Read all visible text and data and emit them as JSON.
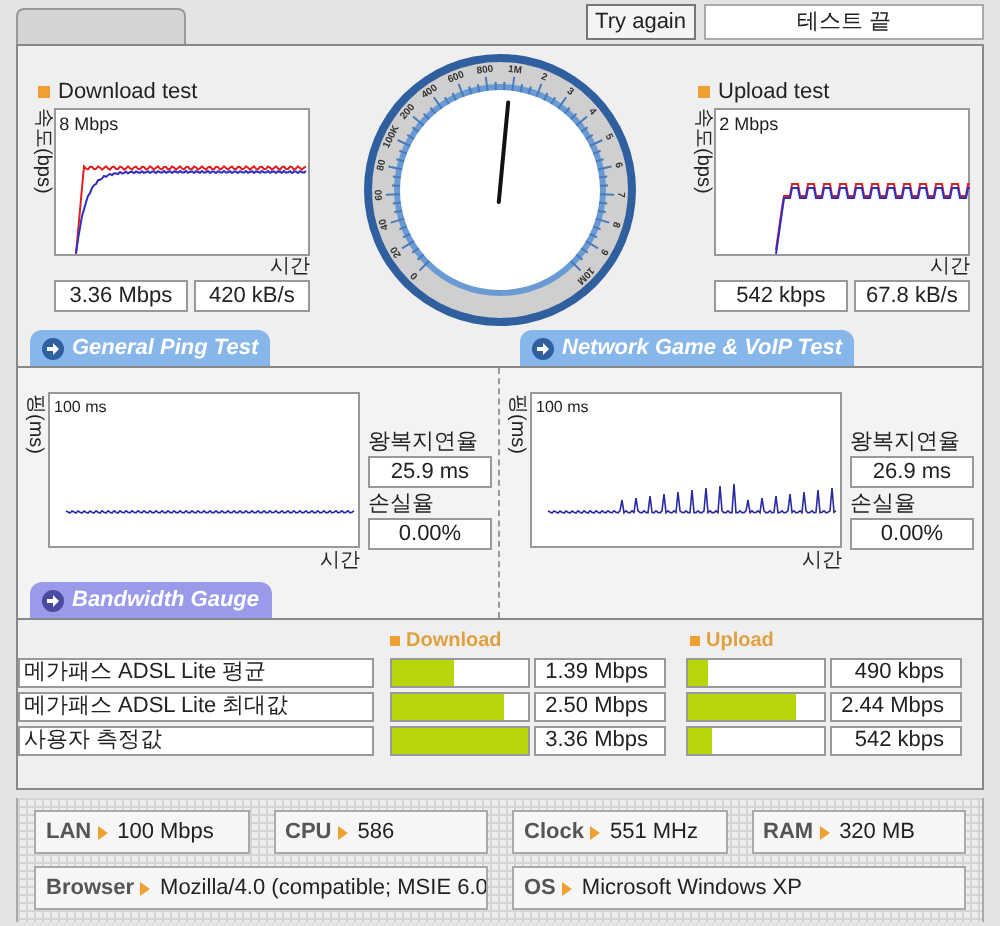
{
  "toolbar": {
    "retry_button": "Try again",
    "status": "테스트 끝"
  },
  "download": {
    "title": "Download test",
    "y_label": "속도(bps)",
    "max": "8 Mbps",
    "x_label": "시간",
    "speed": "3.36 Mbps",
    "rate": "420 kB/s"
  },
  "gauge": {
    "labels": [
      "0",
      "20",
      "40",
      "60",
      "80",
      "100K",
      "200",
      "400",
      "600",
      "800",
      "1M",
      "2",
      "3",
      "4",
      "5",
      "6",
      "7",
      "8",
      "9",
      "10M"
    ],
    "level": 0.52
  },
  "upload": {
    "title": "Upload test",
    "y_label": "속도(bps)",
    "max": "2 Mbps",
    "x_label": "시간",
    "speed": "542 kbps",
    "rate": "67.8 kB/s"
  },
  "ping_tabs": [
    "General Ping Test",
    "Network Game & VoIP Test"
  ],
  "ping": [
    {
      "y_label": "핑(ms)",
      "max": "100 ms",
      "x_label": "시간",
      "latency_label": "왕복지연율",
      "latency": "25.9 ms",
      "loss_label": "손실율",
      "loss": "0.00%"
    },
    {
      "y_label": "핑(ms)",
      "max": "100 ms",
      "x_label": "시간",
      "latency_label": "왕복지연율",
      "latency": "26.9 ms",
      "loss_label": "손실율",
      "loss": "0.00%"
    }
  ],
  "bandwidth": {
    "title": "Bandwidth Gauge",
    "download_header": "Download",
    "upload_header": "Upload",
    "rows": [
      {
        "label": "메가패스 ADSL Lite 평균",
        "download": {
          "level": 0.45,
          "value": "1.39 Mbps"
        },
        "upload": {
          "level": 0.15,
          "value": "490 kbps"
        }
      },
      {
        "label": "메가패스 ADSL Lite 최대값",
        "download": {
          "level": 0.83,
          "value": "2.50 Mbps"
        },
        "upload": {
          "level": 0.79,
          "value": "2.44 Mbps"
        }
      },
      {
        "label": "사용자 측정값",
        "download": {
          "level": 1.0,
          "value": "3.36 Mbps"
        },
        "upload": {
          "level": 0.17,
          "value": "542 kbps"
        }
      }
    ]
  },
  "system_info": [
    {
      "label": "LAN",
      "value": "100 Mbps"
    },
    {
      "label": "CPU",
      "value": "586"
    },
    {
      "label": "Clock",
      "value": "551 MHz"
    },
    {
      "label": "RAM",
      "value": "320 MB"
    },
    {
      "label": "Browser",
      "value": "Mozilla/4.0 (compatible; MSIE 6.0"
    },
    {
      "label": "OS",
      "value": "Microsoft Windows XP"
    }
  ]
}
